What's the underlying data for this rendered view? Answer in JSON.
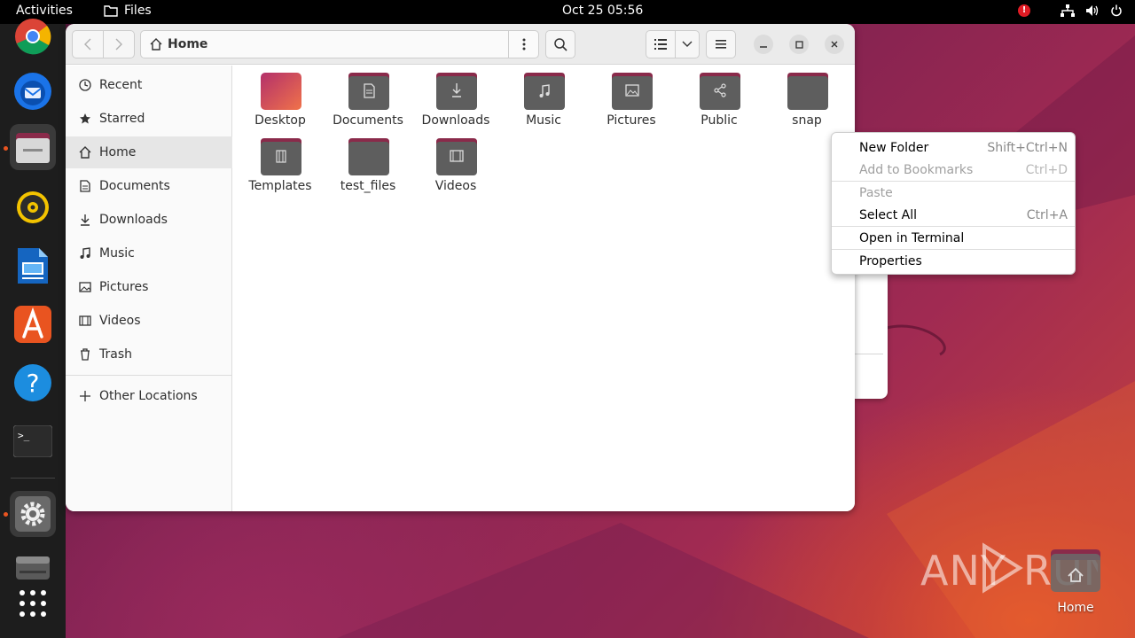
{
  "topbar": {
    "activities": "Activities",
    "app_name": "Files",
    "clock": "Oct 25  05:56",
    "alert_glyph": "!"
  },
  "dock": {
    "items": [
      {
        "name": "chrome-icon"
      },
      {
        "name": "thunderbird-icon"
      },
      {
        "name": "files-icon",
        "active": true
      },
      {
        "name": "rhythmbox-icon"
      },
      {
        "name": "libreoffice-writer-icon"
      },
      {
        "name": "app-center-icon"
      },
      {
        "name": "help-icon"
      },
      {
        "name": "terminal-icon"
      },
      {
        "name": "settings-icon"
      },
      {
        "name": "disk-icon"
      },
      {
        "name": "show-apps-icon"
      }
    ],
    "accent": "#e95420"
  },
  "window": {
    "path": {
      "crumb": "Home"
    }
  },
  "sidebar": {
    "items": [
      {
        "label": "Recent"
      },
      {
        "label": "Starred"
      },
      {
        "label": "Home"
      },
      {
        "label": "Documents"
      },
      {
        "label": "Downloads"
      },
      {
        "label": "Music"
      },
      {
        "label": "Pictures"
      },
      {
        "label": "Videos"
      },
      {
        "label": "Trash"
      },
      {
        "label": "Other Locations"
      }
    ]
  },
  "folders": [
    {
      "label": "Desktop"
    },
    {
      "label": "Documents"
    },
    {
      "label": "Downloads"
    },
    {
      "label": "Music"
    },
    {
      "label": "Pictures"
    },
    {
      "label": "Public"
    },
    {
      "label": "snap"
    },
    {
      "label": "Templates"
    },
    {
      "label": "test_files"
    },
    {
      "label": "Videos"
    }
  ],
  "context_menu": {
    "items": [
      {
        "label": "New Folder",
        "accel": "Shift+Ctrl+N",
        "enabled": true
      },
      {
        "label": "Add to Bookmarks",
        "accel": "Ctrl+D",
        "enabled": false
      },
      {
        "label": "Paste",
        "accel": "",
        "enabled": false
      },
      {
        "label": "Select All",
        "accel": "Ctrl+A",
        "enabled": true
      },
      {
        "label": "Open in Terminal",
        "accel": "",
        "enabled": true
      },
      {
        "label": "Properties",
        "accel": "",
        "enabled": true
      }
    ]
  },
  "desktop": {
    "home_label": "Home",
    "watermark": "ANY RUN"
  },
  "colors": {
    "folder_body": "#5e5e5e",
    "folder_tab": "#8a2a4a",
    "selection": "#e6e6e6"
  }
}
